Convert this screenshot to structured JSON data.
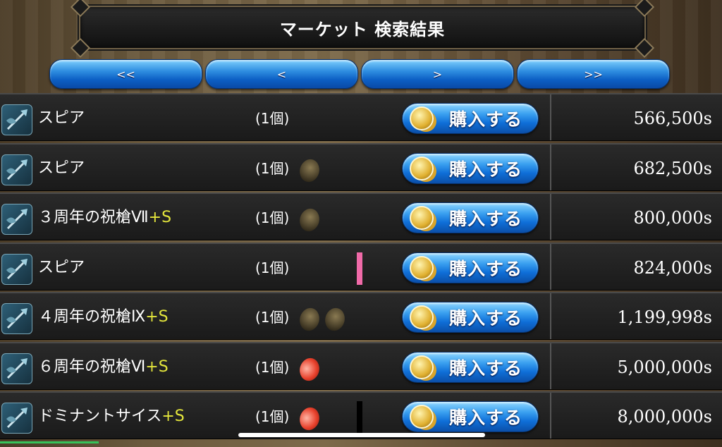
{
  "header": {
    "title": "マーケット 検索結果"
  },
  "nav": {
    "first_label": "<<",
    "prev_label": "<",
    "next_label": ">",
    "last_label": ">>"
  },
  "buy_label": "購入する",
  "rows": [
    {
      "name": "スピア",
      "plus": "",
      "qty": "(1個)",
      "orbs": [],
      "marker": "",
      "price": "566,500s"
    },
    {
      "name": "スピア",
      "plus": "",
      "qty": "(1個)",
      "orbs": [
        "dark"
      ],
      "marker": "",
      "price": "682,500s"
    },
    {
      "name": "３周年の祝槍Ⅶ",
      "plus": "+S",
      "qty": "(1個)",
      "orbs": [
        "dark"
      ],
      "marker": "",
      "price": "800,000s"
    },
    {
      "name": "スピア",
      "plus": "",
      "qty": "(1個)",
      "orbs": [],
      "marker": "#f06aa8",
      "price": "824,000s"
    },
    {
      "name": "４周年の祝槍Ⅸ",
      "plus": "+S",
      "qty": "(1個)",
      "orbs": [
        "dark",
        "dark"
      ],
      "marker": "",
      "price": "1,199,998s"
    },
    {
      "name": "６周年の祝槍Ⅵ",
      "plus": "+S",
      "qty": "(1個)",
      "orbs": [
        "red"
      ],
      "marker": "",
      "price": "5,000,000s"
    },
    {
      "name": "ドミナントサイス",
      "plus": "+S",
      "qty": "(1個)",
      "orbs": [
        "red"
      ],
      "marker": "#000000",
      "price": "8,000,000s"
    }
  ]
}
